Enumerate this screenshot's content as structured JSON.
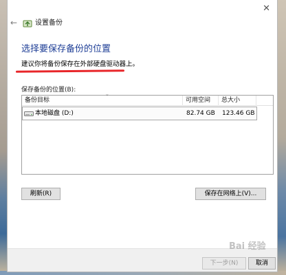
{
  "window": {
    "title": "设置备份",
    "close_glyph": "✕",
    "back_glyph": "←"
  },
  "heading": "选择要保存备份的位置",
  "hint": "建议你将备份保存在外部硬盘驱动器上。",
  "list": {
    "label": "保存备份的位置(B):",
    "columns": [
      "备份目标",
      "可用空间",
      "总大小"
    ],
    "rows": [
      {
        "name": "本地磁盘 (D:)",
        "free": "82.74 GB",
        "total": "123.46 GB",
        "icon": "drive-icon"
      }
    ]
  },
  "buttons": {
    "refresh": "刷新(R)",
    "save_network": "保存在网络上(V)...",
    "next": "下一步(N)",
    "cancel": "取消"
  },
  "watermark": "Bai 经验",
  "colors": {
    "heading": "#1e3e96",
    "annotation_underline": "#e8262a"
  }
}
